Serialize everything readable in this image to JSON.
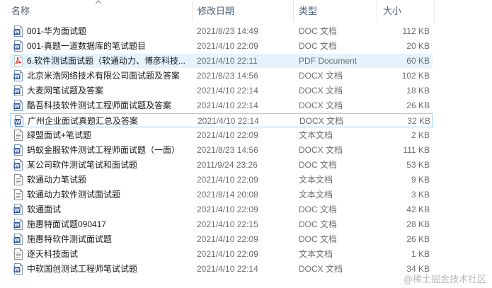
{
  "header": {
    "name": "名称",
    "modified": "修改日期",
    "type": "类型",
    "size": "大小"
  },
  "files": [
    {
      "name": "001-华为面试题",
      "modified": "2021/8/23 14:49",
      "type": "DOC 文档",
      "size": "112 KB",
      "icon": "word-doc-icon"
    },
    {
      "name": "001-真题一道数据库的笔试题目",
      "modified": "2021/4/10 22:09",
      "type": "DOC 文档",
      "size": "20 KB",
      "icon": "word-doc-icon"
    },
    {
      "name": "6.软件测试面试题（软通动力、博彦科技...",
      "modified": "2021/4/10 22:11",
      "type": "PDF Document",
      "size": "60 KB",
      "icon": "pdf-icon"
    },
    {
      "name": "北京米浩网络技术有限公司面试题及答案",
      "modified": "2021/8/23 14:56",
      "type": "DOCX 文档",
      "size": "102 KB",
      "icon": "word-doc-icon"
    },
    {
      "name": "大麦网笔试题及答案",
      "modified": "2021/4/10 22:14",
      "type": "DOCX 文档",
      "size": "18 KB",
      "icon": "word-doc-icon"
    },
    {
      "name": "酷吾科技软件测试工程师面试题及答案",
      "modified": "2021/4/10 22:14",
      "type": "DOCX 文档",
      "size": "26 KB",
      "icon": "word-doc-icon"
    },
    {
      "name": "广州企业面试真题汇总及答案",
      "modified": "2021/4/10 22:14",
      "type": "DOCX 文档",
      "size": "32 KB",
      "icon": "word-doc-icon"
    },
    {
      "name": "绿盟面试+笔试题",
      "modified": "2021/4/10 22:09",
      "type": "文本文档",
      "size": "2 KB",
      "icon": "text-doc-icon"
    },
    {
      "name": "蚂蚁金服软件测试工程师面试题（一面）",
      "modified": "2021/8/23 14:56",
      "type": "DOCX 文档",
      "size": "111 KB",
      "icon": "word-doc-icon"
    },
    {
      "name": "某公司软件测试笔试和面试题",
      "modified": "2011/9/24 23:26",
      "type": "DOC 文档",
      "size": "53 KB",
      "icon": "word-doc-icon"
    },
    {
      "name": "软通动力笔试题",
      "modified": "2021/4/10 22:09",
      "type": "文本文档",
      "size": "9 KB",
      "icon": "text-doc-icon"
    },
    {
      "name": "软通动力软件测试面试题",
      "modified": "2021/8/14 20:08",
      "type": "文本文档",
      "size": "3 KB",
      "icon": "text-doc-icon"
    },
    {
      "name": "软通面试",
      "modified": "2021/4/10 22:09",
      "type": "DOC 文档",
      "size": "42 KB",
      "icon": "word-doc-icon"
    },
    {
      "name": "施惠特面试题090417",
      "modified": "2021/4/10 22:15",
      "type": "DOC 文档",
      "size": "28 KB",
      "icon": "word-doc-icon"
    },
    {
      "name": "施惠特软件测试面试题",
      "modified": "2021/4/10 22:09",
      "type": "DOC 文档",
      "size": "26 KB",
      "icon": "word-doc-icon"
    },
    {
      "name": "逐天科技面试",
      "modified": "2021/4/10 22:09",
      "type": "文本文档",
      "size": "1 KB",
      "icon": "text-doc-icon"
    },
    {
      "name": "中软国创测试工程师笔试试题",
      "modified": "2021/4/10 22:14",
      "type": "DOCX 文档",
      "size": "34 KB",
      "icon": "word-doc-icon"
    }
  ],
  "watermark": "@稀土掘金技术社区",
  "colors": {
    "header_text": "#4c607a",
    "hover_bg": "#e5f3ff",
    "focus_border": "#99d1ff",
    "word_blue": "#2b579a",
    "pdf_red": "#e0302d"
  }
}
